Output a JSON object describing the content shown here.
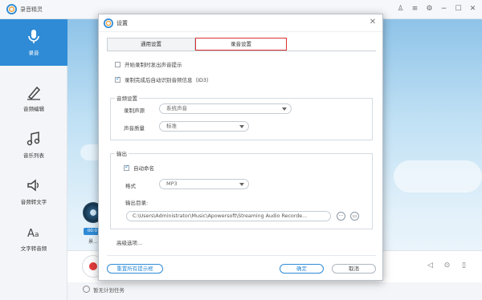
{
  "app": {
    "title": "录音精灵",
    "sidebar": [
      {
        "label": "录音",
        "icon": "microphone-icon"
      },
      {
        "label": "音频编辑",
        "icon": "pen-icon"
      },
      {
        "label": "音乐列表",
        "icon": "music-note-icon"
      },
      {
        "label": "音频转文字",
        "icon": "speaker-icon"
      },
      {
        "label": "文字转音频",
        "icon": "text-to-speech-icon"
      }
    ],
    "time_pill": "00:0",
    "partial_text": "景...",
    "status_text": "暂无计划任务"
  },
  "dialog": {
    "title": "设置",
    "tabs": [
      "通用设置",
      "录音设置"
    ],
    "active_tab": "录音设置",
    "options": [
      {
        "label": "开始录制时发出声音提示",
        "checked": false
      },
      {
        "label": "录制完成后自动识别音频信息（ID3）",
        "checked": true
      }
    ],
    "audio_settings": {
      "title": "音频设置",
      "source_label": "录制声源",
      "source_value": "系统声音",
      "quality_label": "声音质量",
      "quality_value": "标准"
    },
    "output": {
      "title": "输出",
      "auto_name_label": "自动命名",
      "auto_name_checked": true,
      "format_label": "格式",
      "format_value": "MP3",
      "dir_label": "输出目录:",
      "dir_value": "C:\\Users\\Administrator\\Music\\Apowersoft\\Streaming Audio Recorde...",
      "more_btn": "···"
    },
    "advanced_link": "高级选项...",
    "buttons": {
      "reset": "重置所有提示框",
      "ok": "确定",
      "cancel": "取消"
    }
  },
  "colors": {
    "accent": "#2f8bd6",
    "tab_highlight": "#d9322f",
    "record": "#e23b3b"
  }
}
